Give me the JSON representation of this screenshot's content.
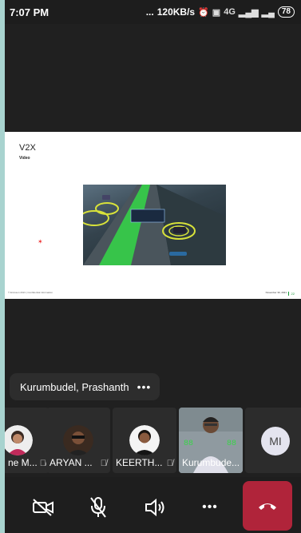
{
  "status_bar": {
    "time": "7:07 PM",
    "speed": "120KB/s",
    "signal_type": "4G",
    "battery": "78",
    "dots": "..."
  },
  "slide": {
    "title": "V2X",
    "subtitle": "Video",
    "footer_left": "© Ericsson 2021 | Confidential information",
    "footer_right": "November 30, 2021",
    "page": "22",
    "video_sign": "ECO-LANE AVAILABLE"
  },
  "presenter": {
    "name": "Kurumbudel, Prashanth",
    "more": "•••"
  },
  "participants": [
    {
      "label": "ne M...",
      "muted": true
    },
    {
      "label": "ARYAN ...",
      "muted": true
    },
    {
      "label": "KEERTH...",
      "muted": true
    },
    {
      "label": "Kurumbude...",
      "muted": false
    },
    {
      "label": "",
      "initials": "MI"
    }
  ],
  "controls": {
    "more": "•••"
  },
  "colors": {
    "end_call": "#b0243a",
    "background": "#202020"
  }
}
